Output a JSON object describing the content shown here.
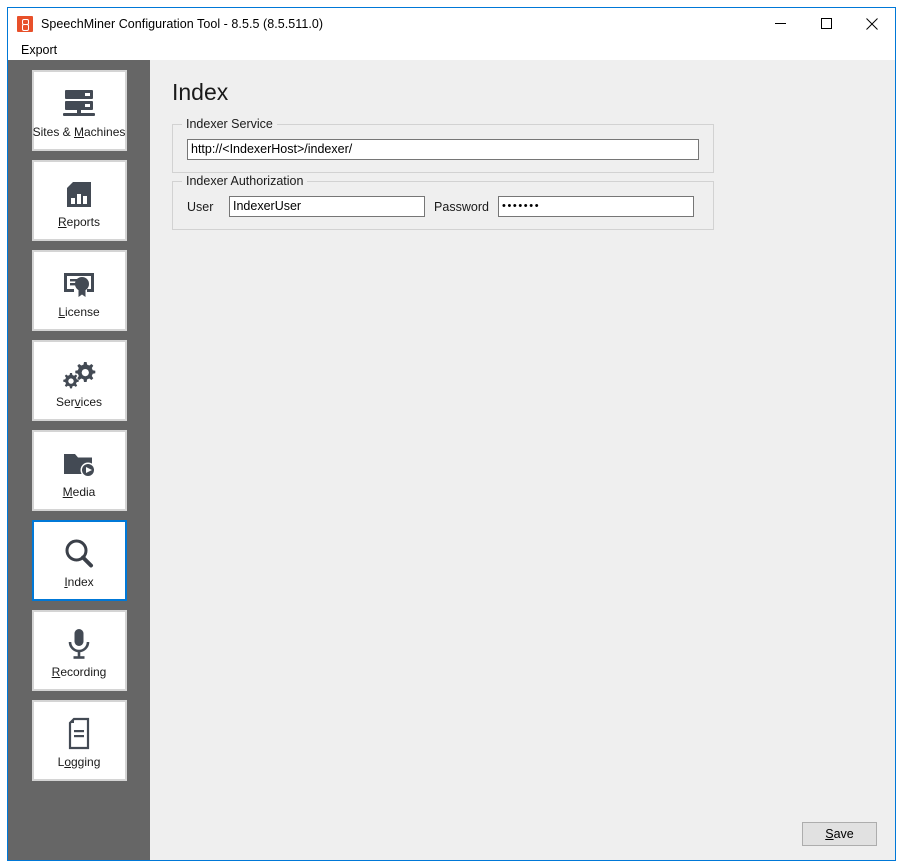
{
  "window": {
    "title": "SpeechMiner Configuration Tool - 8.5.5 (8.5.511.0)",
    "app_icon": "speechminer-logo-icon",
    "accent_color": "#0078d7",
    "brand_color": "#e8502a",
    "controls": {
      "minimize": "minimize-icon",
      "maximize": "maximize-icon",
      "close": "close-icon"
    }
  },
  "menubar": {
    "items": [
      {
        "label": "Export"
      }
    ]
  },
  "sidebar": {
    "background_color": "#666666",
    "items": [
      {
        "label_pre": "Sites & ",
        "label_key": "M",
        "label_post": "achines",
        "icon": "server-rack-icon",
        "selected": false
      },
      {
        "label_pre": "",
        "label_key": "R",
        "label_post": "eports",
        "icon": "report-chart-icon",
        "selected": false
      },
      {
        "label_pre": "",
        "label_key": "L",
        "label_post": "icense",
        "icon": "certificate-icon",
        "selected": false
      },
      {
        "label_pre": "Ser",
        "label_key": "v",
        "label_post": "ices",
        "icon": "gears-icon",
        "selected": false
      },
      {
        "label_pre": "",
        "label_key": "M",
        "label_post": "edia",
        "icon": "media-folder-icon",
        "selected": false
      },
      {
        "label_pre": "",
        "label_key": "I",
        "label_post": "ndex",
        "icon": "magnifier-icon",
        "selected": true
      },
      {
        "label_pre": "",
        "label_key": "R",
        "label_post": "ecording",
        "icon": "microphone-icon",
        "selected": false
      },
      {
        "label_pre": "L",
        "label_key": "o",
        "label_post": "gging",
        "icon": "document-lines-icon",
        "selected": false
      }
    ]
  },
  "main": {
    "page_title": "Index",
    "groups": [
      {
        "title": "Indexer Service",
        "fields": [
          {
            "name": "indexer-service-url",
            "label": "",
            "value": "http://<IndexerHost>/indexer/",
            "placeholder": "",
            "type": "text"
          }
        ]
      },
      {
        "title": "Indexer Authorization",
        "fields": [
          {
            "name": "indexer-user",
            "label": "User",
            "value": "IndexerUser",
            "placeholder": "",
            "type": "text"
          },
          {
            "name": "indexer-password",
            "label": "Password",
            "value": "•••••••",
            "placeholder": "",
            "type": "password"
          }
        ]
      }
    ]
  },
  "footer": {
    "save_pre": "",
    "save_key": "S",
    "save_post": "ave"
  }
}
